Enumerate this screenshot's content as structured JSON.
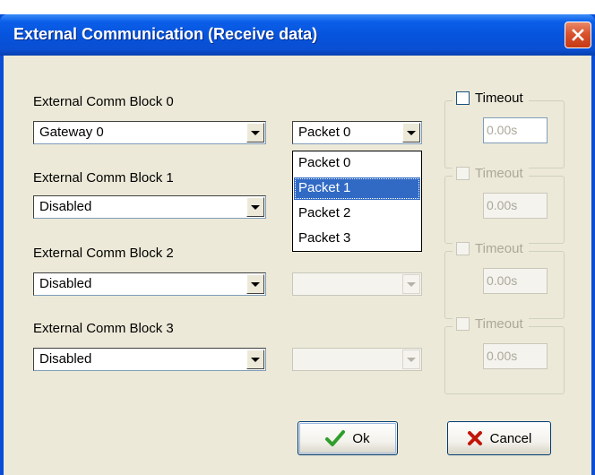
{
  "window": {
    "title": "External Communication (Receive data)",
    "close_icon": "close-icon"
  },
  "blocks": [
    {
      "label": "External Comm Block 0",
      "source": "Gateway 0",
      "packet": "Packet 0",
      "timeout_label": "Timeout",
      "timeout_value": "0.00s"
    },
    {
      "label": "External Comm Block 1",
      "source": "Disabled",
      "packet": "",
      "timeout_label": "Timeout",
      "timeout_value": "0.00s"
    },
    {
      "label": "External Comm Block 2",
      "source": "Disabled",
      "packet": "",
      "timeout_label": "Timeout",
      "timeout_value": "0.00s"
    },
    {
      "label": "External Comm Block 3",
      "source": "Disabled",
      "packet": "",
      "timeout_label": "Timeout",
      "timeout_value": "0.00s"
    }
  ],
  "dropdown": {
    "items": [
      "Packet 0",
      "Packet 1",
      "Packet 2",
      "Packet 3"
    ],
    "highlighted": "Packet 1"
  },
  "buttons": {
    "ok_label": "Ok",
    "ok_icon": "checkmark-icon",
    "cancel_label": "Cancel",
    "cancel_icon": "x-icon"
  },
  "colors": {
    "titlebar": "#0653dc",
    "selection": "#316ac5",
    "ok_check": "#2f9e2a",
    "cancel_x": "#c0170a"
  }
}
